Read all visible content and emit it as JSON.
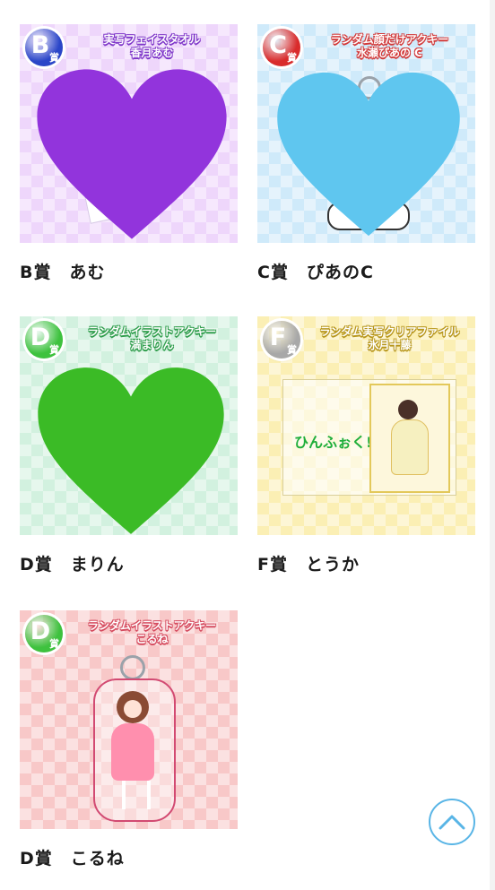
{
  "cards": [
    {
      "badge_letter": "B",
      "badge_suffix": "賞",
      "badge_color": "#2a46c8",
      "bg_color": "#eed6fb",
      "prize_title_line1": "実写フェイスタオル",
      "prize_title_line2": "香月あむ",
      "caption": "B賞　あむ",
      "overlay": "purple-heart",
      "overlay_color": "#9234dc"
    },
    {
      "badge_letter": "C",
      "badge_suffix": "賞",
      "badge_color": "#d92b2b",
      "bg_color": "#cfeafa",
      "prize_title_line1": "ランダム顔だけアクキー",
      "prize_title_line2": "水瀬ぴあの C",
      "caption": "C賞　ぴあのC",
      "overlay": "light-blue-heart",
      "overlay_color": "#5fc6ef"
    },
    {
      "badge_letter": "D",
      "badge_suffix": "賞",
      "badge_color": "#3ec23e",
      "bg_color": "#d2f1df",
      "prize_title_line1": "ランダムイラストアクキー",
      "prize_title_line2": "満まりん",
      "caption": "D賞　まりん",
      "overlay": "green-heart",
      "overlay_color": "#3bbb26"
    },
    {
      "badge_letter": "F",
      "badge_suffix": "賞",
      "badge_color": "#a8a8a8",
      "bg_color": "#fbefb4",
      "prize_title_line1": "ランダム実写クリアファイル",
      "prize_title_line2": "氷月十藤",
      "caption": "F賞　とうか",
      "file_logo": "ひんふぉく!",
      "overlay": "clear-file"
    },
    {
      "badge_letter": "D",
      "badge_suffix": "賞",
      "badge_color": "#3ec23e",
      "bg_color": "#f8c8c8",
      "prize_title_line1": "ランダムイラストアクキー",
      "prize_title_line2": "こるね",
      "caption": "D賞　こるね",
      "overlay": "acrylic-keychain"
    }
  ],
  "back_to_top": {
    "icon": "chevron-up-icon",
    "color": "#59b5e6"
  }
}
